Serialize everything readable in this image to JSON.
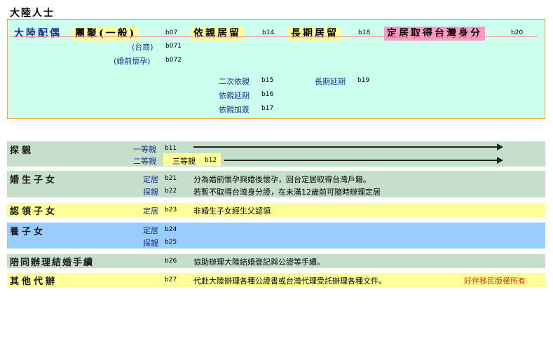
{
  "page_title": "大陸人士",
  "panel": {
    "main_label": "大陸配偶",
    "categories": [
      {
        "label": "團聚(一般)",
        "code": "b07"
      },
      {
        "label": "依親居留",
        "code": "b14"
      },
      {
        "label": "長期居留",
        "code": "b18"
      },
      {
        "label": "定居取得台灣身分",
        "code": "b20"
      }
    ],
    "sub_tuanju": [
      {
        "label": "(台商)",
        "code": "b071"
      },
      {
        "label": "(婚前懷孕)",
        "code": "b072"
      }
    ],
    "sub_yiqin": [
      {
        "label": "二次依親",
        "code": "b15"
      },
      {
        "label": "依親延期",
        "code": "b16"
      },
      {
        "label": "依親加簽",
        "code": "b17"
      }
    ],
    "sub_changqi": [
      {
        "label": "長期延期",
        "code": "b19"
      }
    ]
  },
  "sections": {
    "tanqin": {
      "title": "探親",
      "rows": [
        {
          "label": "一等親",
          "code": "b11"
        },
        {
          "label": "二等親",
          "extra_label": "三等親",
          "code": "b12"
        }
      ]
    },
    "hunsheng": {
      "title": "婚生子女",
      "rows": [
        {
          "label": "定居",
          "code": "b21",
          "desc": "分為婚前懷孕與婚後懷孕，回台定居取得台灣戶籍。"
        },
        {
          "label": "探親",
          "code": "b22",
          "desc": "若暫不取得台灣身分證，在未滿12歲前可隨時辦理定居"
        }
      ]
    },
    "renling": {
      "title": "認領子女",
      "rows": [
        {
          "label": "定居",
          "code": "b23",
          "desc": "非婚生子女經生父認領"
        }
      ]
    },
    "yangzi": {
      "title": "養子女",
      "rows": [
        {
          "label": "定居",
          "code": "b24"
        },
        {
          "label": "探親",
          "code": "b25"
        }
      ]
    },
    "peitong": {
      "title": "陪同辦理結婚手續",
      "code": "b26",
      "desc": "協助辦理大陸結婚登記與公證等手續。"
    },
    "qita": {
      "title": "其他代辦",
      "code": "b27",
      "desc": "代赴大陸辦理各種公證書或台灣代理受託辦理各種文件。",
      "copyright": "好伴移民版權所有"
    }
  },
  "colors": {
    "panel_bg": "#ccffee",
    "panel_border": "#f2a23a",
    "green_band": "#c6dfcb",
    "yellow_band": "#ffff99",
    "blue_band": "#99ccff",
    "pink_highlight": "#ff99cc",
    "copyright_red": "#ff3300"
  }
}
